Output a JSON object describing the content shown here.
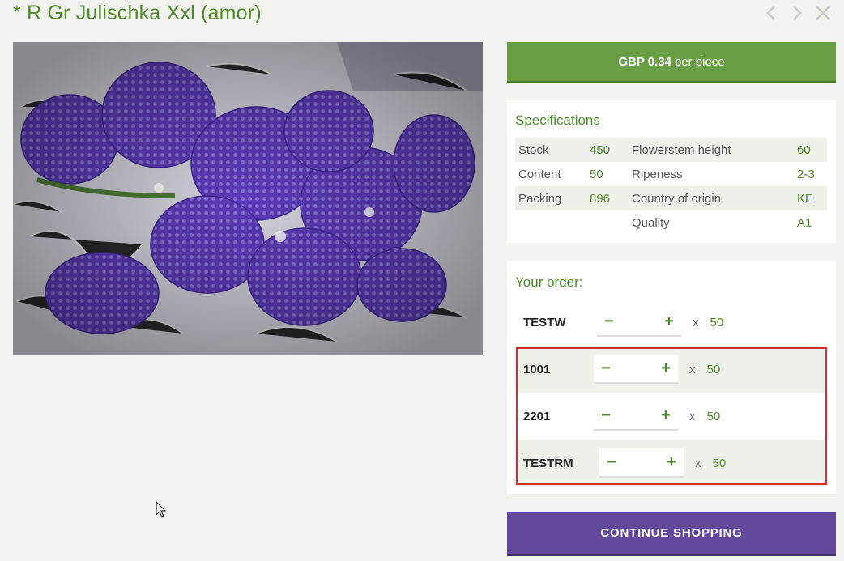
{
  "product": {
    "title": "* R Gr Julischka Xxl (amor)"
  },
  "nav": {
    "prev_icon": "chevron-left-icon",
    "next_icon": "chevron-right-icon",
    "close_icon": "close-icon"
  },
  "price": {
    "amount": "GBP 0.34",
    "unit": "per piece"
  },
  "specifications": {
    "title": "Specifications",
    "rows": [
      {
        "label1": "Stock",
        "value1": "450",
        "label2": "Flowerstem height",
        "value2": "60"
      },
      {
        "label1": "Content",
        "value1": "50",
        "label2": "Ripeness",
        "value2": "2-3"
      },
      {
        "label1": "Packing",
        "value1": "896",
        "label2": "Country of origin",
        "value2": "KE"
      },
      {
        "label1": "",
        "value1": "",
        "label2": "Quality",
        "value2": "A1"
      }
    ]
  },
  "order": {
    "title": "Your order:",
    "minus": "−",
    "plus": "+",
    "times": "x",
    "rows": [
      {
        "code": "TESTW",
        "quantity": "",
        "unit": "50"
      },
      {
        "code": "1001",
        "quantity": "",
        "unit": "50"
      },
      {
        "code": "2201",
        "quantity": "",
        "unit": "50"
      },
      {
        "code": "TESTRM",
        "quantity": "",
        "unit": "50"
      }
    ]
  },
  "continue": {
    "label": "CONTINUE SHOPPING"
  },
  "colors": {
    "brand_green": "#6a9e45",
    "text_green": "#4e8a2c",
    "purple": "#62479a",
    "highlight_red": "#d32c2c"
  }
}
